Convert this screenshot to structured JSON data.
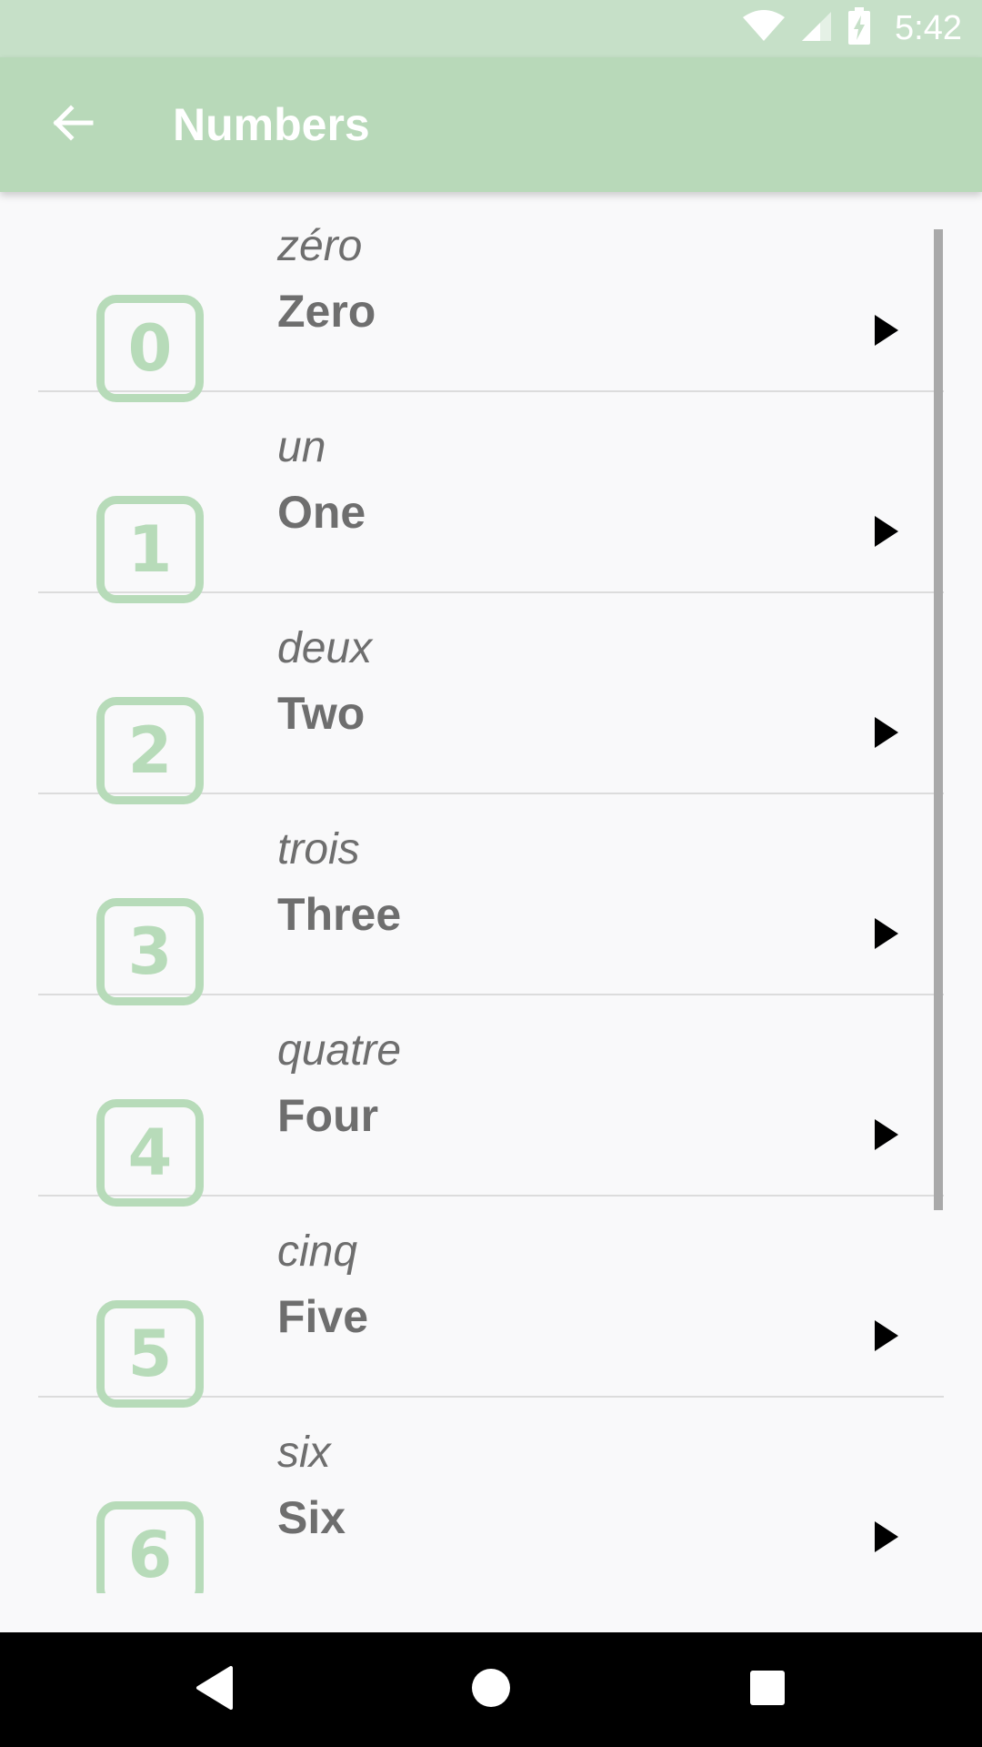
{
  "status_bar": {
    "time": "5:42",
    "icons": [
      "wifi-icon",
      "signal-icon",
      "battery-charging-icon"
    ]
  },
  "app_bar": {
    "title": "Numbers",
    "back_icon": "arrow-left-icon"
  },
  "colors": {
    "status_bar": "#c6e0c8",
    "app_bar": "#b8d9b9",
    "number_box": "#b7dbb9",
    "text": "#6e6e6e",
    "background": "#f9f9fa"
  },
  "items": [
    {
      "number": "0",
      "french": "zéro",
      "english": "Zero"
    },
    {
      "number": "1",
      "french": "un",
      "english": "One"
    },
    {
      "number": "2",
      "french": "deux",
      "english": "Two"
    },
    {
      "number": "3",
      "french": "trois",
      "english": "Three"
    },
    {
      "number": "4",
      "french": "quatre",
      "english": "Four"
    },
    {
      "number": "5",
      "french": "cinq",
      "english": "Five"
    },
    {
      "number": "6",
      "french": "six",
      "english": "Six"
    }
  ],
  "nav_bar": {
    "icons": [
      "back-triangle-icon",
      "home-circle-icon",
      "recents-square-icon"
    ]
  }
}
